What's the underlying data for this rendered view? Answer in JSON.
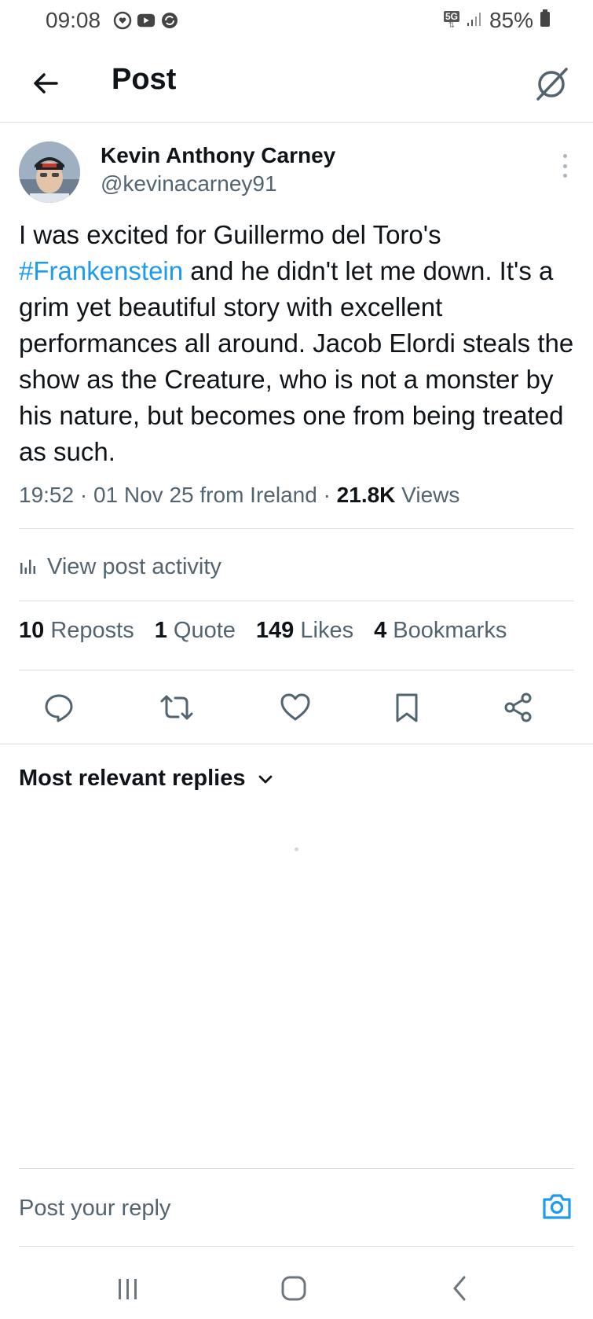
{
  "status_bar": {
    "time": "09:08",
    "network": "5G",
    "battery": "85%"
  },
  "header": {
    "title": "Post"
  },
  "post": {
    "author_name": "Kevin Anthony Carney",
    "author_handle": "@kevinacarney91",
    "text_before_hashtag": "I was excited for Guillermo del Toro's ",
    "hashtag": "#Frankenstein",
    "text_after_hashtag": " and he didn't let me down. It's a grim yet beautiful story with excellent performances all around. Jacob Elordi steals the show as the Creature, who is not a monster by his nature, but becomes one from being treated as such.",
    "meta_time": "19:52",
    "meta_date": "01 Nov 25 from Ireland",
    "views_count": "21.8K",
    "views_label": "Views",
    "activity_label": "View post activity",
    "stats": {
      "reposts_count": "10",
      "reposts_label": "Reposts",
      "quotes_count": "1",
      "quotes_label": "Quote",
      "likes_count": "149",
      "likes_label": "Likes",
      "bookmarks_count": "4",
      "bookmarks_label": "Bookmarks"
    }
  },
  "replies": {
    "sort_label": "Most relevant replies"
  },
  "reply_box": {
    "placeholder": "Post your reply"
  },
  "colors": {
    "accent": "#1d9bf0",
    "text_primary": "#0f1419",
    "text_secondary": "#536471",
    "divider": "#dcdfe2"
  },
  "icons": [
    "back-arrow-icon",
    "grok-icon",
    "more-vertical-icon",
    "stats-icon",
    "reply-icon",
    "repost-icon",
    "like-icon",
    "bookmark-icon",
    "share-icon",
    "chevron-down-icon",
    "camera-icon",
    "recents-icon",
    "home-icon",
    "back-nav-icon"
  ]
}
